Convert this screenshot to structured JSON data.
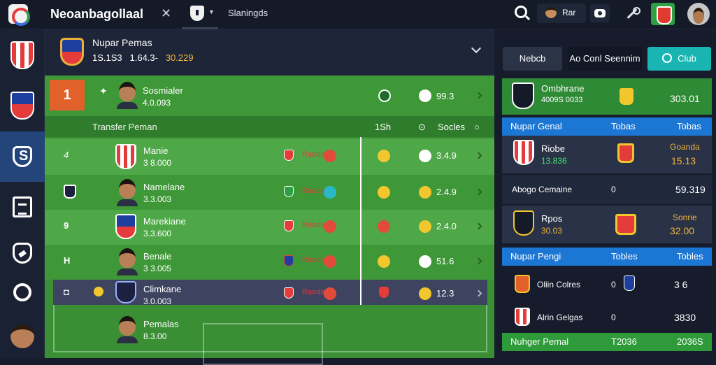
{
  "app": {
    "title": "Neoanbagollaal",
    "active_tab": "Slaningds"
  },
  "topbar": {
    "user_chip": "Rar"
  },
  "header": {
    "title": "Nupar Pemas",
    "meta_a": "1S.1S3",
    "meta_b": "1.64.3-",
    "meta_c": "30.229"
  },
  "table": {
    "top_row": {
      "rank": "1",
      "marker": "✦",
      "name": "Sosmialer",
      "value": "4.0.093",
      "score": "99.3"
    },
    "header": {
      "title": "Transfer Peman",
      "col_1": "1Sh",
      "col_2": "Socles"
    },
    "rows": [
      {
        "marker": "4",
        "name": "Manie",
        "value": "3 8.000",
        "badge": "Raoda",
        "score": "3.4.9"
      },
      {
        "marker": "",
        "name": "Namelane",
        "value": "3.3.003",
        "badge": "Raoda",
        "score": "2.4.9"
      },
      {
        "marker": "9",
        "name": "Marekiane",
        "value": "3.3.600",
        "badge": "Raoda",
        "score": "2.4.0"
      },
      {
        "marker": "H",
        "name": "Benale",
        "value": "3 3.005",
        "badge": "Raoda",
        "score": "51.6"
      },
      {
        "marker": "◘",
        "name": "Climkane",
        "value": "3.0.003",
        "badge": "Raoda",
        "score": "12.3"
      },
      {
        "marker": "",
        "name": "Pemalas",
        "value": "8.3.00",
        "badge": "",
        "score": ""
      }
    ]
  },
  "right_panel": {
    "buttons": [
      "Nebcb",
      "Ao Conl Seennim",
      "Club"
    ],
    "featured": {
      "name": "Ombhrane",
      "meta": "4009S 0033",
      "score": "303.01"
    },
    "section_1": {
      "title": "Nupar Genal",
      "col_a": "Tobas",
      "col_b": "Tobas"
    },
    "items_1": [
      {
        "name": "Riobe",
        "sub": "13.836",
        "label": "Goanda",
        "value": "15.13"
      },
      {
        "name": "Abogo Cemaine",
        "sub": "",
        "label": "0",
        "value": "59.319"
      },
      {
        "name": "Rpos",
        "sub": "30.03",
        "label": "Sonrie",
        "value": "32.00"
      }
    ],
    "section_2": {
      "title": "Nupar Pengi",
      "col_a": "Tobles",
      "col_b": "Tobles"
    },
    "items_2": [
      {
        "name": "Oliin Colres",
        "label": "0",
        "value": "3 6"
      },
      {
        "name": "Alrin Gelgas",
        "label": "0",
        "value": "3830"
      }
    ],
    "footer": {
      "title": "Nuhger Pemal",
      "col_a": "T2036",
      "col_b": "2036S"
    }
  }
}
